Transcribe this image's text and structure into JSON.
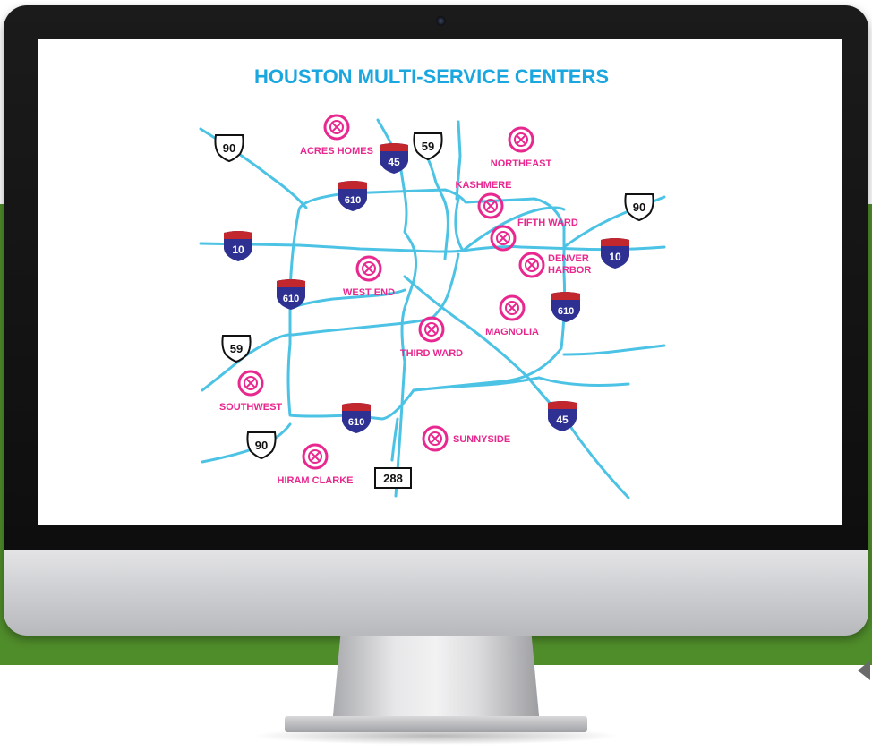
{
  "map": {
    "title": "HOUSTON MULTI-SERVICE CENTERS",
    "colors": {
      "title": "#1aa7e0",
      "roads": "#4cc3e5",
      "center_markers": "#e8288f",
      "interstate_shield": "#2e3192",
      "interstate_top": "#c1272d",
      "green_band": "#4f8c2a"
    },
    "centers": [
      {
        "id": "acres-homes",
        "label": "ACRES HOMES"
      },
      {
        "id": "northeast",
        "label": "NORTHEAST"
      },
      {
        "id": "kashmere",
        "label": "KASHMERE"
      },
      {
        "id": "fifth-ward",
        "label": "FIFTH WARD"
      },
      {
        "id": "denver-harbor",
        "label": "DENVER HARBOR",
        "lines": [
          "DENVER",
          "HARBOR"
        ]
      },
      {
        "id": "west-end",
        "label": "WEST END"
      },
      {
        "id": "magnolia",
        "label": "MAGNOLIA"
      },
      {
        "id": "third-ward",
        "label": "THIRD WARD"
      },
      {
        "id": "southwest",
        "label": "SOUTHWEST"
      },
      {
        "id": "sunnyside",
        "label": "SUNNYSIDE"
      },
      {
        "id": "hiram-clarke",
        "label": "HIRAM CLARKE"
      }
    ],
    "highway_shields": {
      "interstate": [
        "45",
        "610",
        "10",
        "610",
        "10",
        "610",
        "610",
        "45"
      ],
      "us_route": [
        "90",
        "59",
        "90",
        "59",
        "90"
      ],
      "state": [
        "288"
      ]
    }
  }
}
